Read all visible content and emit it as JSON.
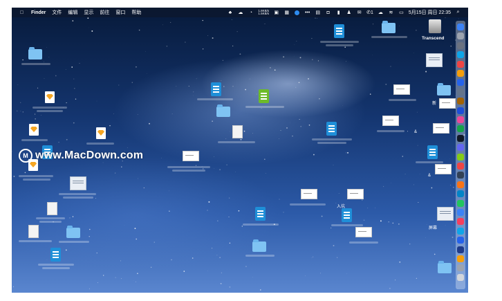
{
  "menubar": {
    "apple_icon": "apple-icon",
    "items": [
      "Finder",
      "文件",
      "编辑",
      "显示",
      "前往",
      "窗口",
      "帮助"
    ],
    "net_up": "1.8KB/s",
    "net_down": "1.5KB/s",
    "datetime": "5月15日 周日 22:35",
    "wechat_badge": "1"
  },
  "drive": {
    "name": "Transcend"
  },
  "fragments": {
    "a": "新",
    "b": "&",
    "c": "&",
    "d": "入坑",
    "e": "屏幕"
  },
  "watermark": {
    "logo": "M",
    "text": "www.MacDown.com"
  },
  "colors": {
    "folder": "#7fc3f3",
    "sheet": "#1f8fd8",
    "sheet_green": "#6dbb2a"
  }
}
